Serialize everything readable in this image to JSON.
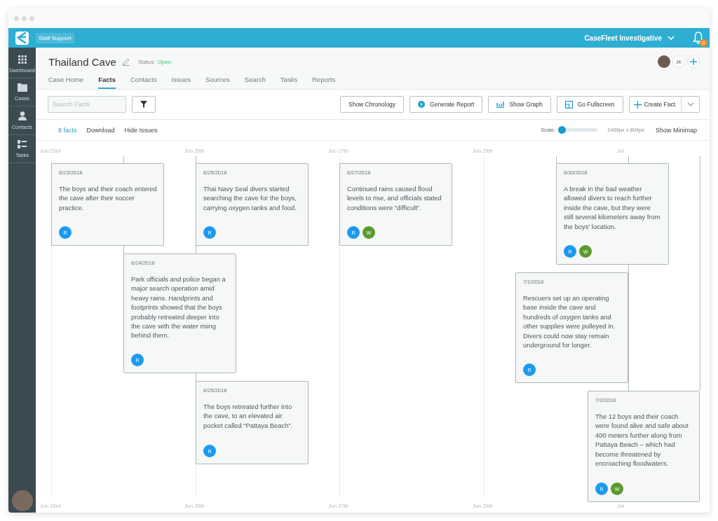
{
  "app_bar": {
    "workspace": "Staff Support",
    "account": "CaseFleet Investigative",
    "notification_count": "0"
  },
  "sidebar": {
    "items": [
      {
        "label": "Dashboard"
      },
      {
        "label": "Cases"
      },
      {
        "label": "Contacts"
      },
      {
        "label": "Tasks"
      }
    ]
  },
  "case": {
    "title": "Thailand Cave",
    "status_label": "Status:",
    "status": "Open",
    "collaborators": [
      "JK"
    ]
  },
  "tabs": [
    {
      "label": "Case Home",
      "selected": false
    },
    {
      "label": "Facts",
      "selected": true
    },
    {
      "label": "Contacts",
      "selected": false
    },
    {
      "label": "Issues",
      "selected": false
    },
    {
      "label": "Sources",
      "selected": false
    },
    {
      "label": "Search",
      "selected": false
    },
    {
      "label": "Tasks",
      "selected": false
    },
    {
      "label": "Reports",
      "selected": false
    }
  ],
  "search": {
    "placeholder": "Search Facts"
  },
  "buttons": [
    {
      "label": "Show Chronology"
    },
    {
      "label": "Generate Report"
    },
    {
      "label": "Show Graph"
    },
    {
      "label": "Go Fullscreen"
    },
    {
      "label": "Create Fact"
    }
  ],
  "subbar": {
    "count": "8 facts",
    "links": [
      "Download",
      "Hide Issues"
    ],
    "scale_label": "Scale:",
    "scale": {
      "level": 0
    },
    "dimensions": "1439px x 804px",
    "minimap": "Show Minimap"
  },
  "timeline": {
    "top_dates": [
      "Jun 23rd",
      "Jun 25th",
      "Jun 27th",
      "Jun 29th",
      "Jul"
    ],
    "bottom_dates": [
      "Jun 23rd",
      "Jun 25th",
      "Jun 27th",
      "Jun 29th",
      "Jul"
    ],
    "facts": [
      {
        "date": "6/23/2018",
        "text": "The boys and their coach entered the cave after their soccer practice.",
        "tags": [
          {
            "letter": "R",
            "color": "#1a9bf0"
          }
        ]
      },
      {
        "date": "6/25/2018",
        "text": "Thai Navy Seal divers started searching the cave for the boys, carrying oxygen tanks and food.",
        "tags": [
          {
            "letter": "R",
            "color": "#1a9bf0"
          }
        ]
      },
      {
        "date": "6/27/2018",
        "text": "Continued rains caused flood levels to rise, and officials stated conditions were “difficult”.",
        "tags": [
          {
            "letter": "R",
            "color": "#1a9bf0"
          },
          {
            "letter": "W",
            "color": "#5a9a2e"
          }
        ]
      },
      {
        "date": "6/30/2018",
        "text": "A break in the bad weather allowed divers to reach further inside the cave, but they were still several kilometers away from the boys' location.",
        "tags": [
          {
            "letter": "R",
            "color": "#1a9bf0"
          },
          {
            "letter": "W",
            "color": "#5a9a2e"
          }
        ]
      },
      {
        "date": "6/24/2018",
        "text": "Park officials and police began a major search operation amid heavy rains. Handprints and footprints showed that the boys probably retreated deeper into the cave with the water rising behind them.",
        "tags": [
          {
            "letter": "R",
            "color": "#1a9bf0"
          }
        ]
      },
      {
        "date": "7/1/2018",
        "text": "Rescuers set up an operating base inside the cave and hundreds of oxygen tanks and other supplies were pulleyed in. Divers could now stay remain underground for longer.",
        "tags": [
          {
            "letter": "R",
            "color": "#1a9bf0"
          }
        ]
      },
      {
        "date": "6/25/2018",
        "text": "The boys retreated further into the cave, to an elevated air pocket called “Pattaya Beach”.",
        "tags": [
          {
            "letter": "R",
            "color": "#1a9bf0"
          }
        ]
      },
      {
        "date": "7/2/2018",
        "text": "The 12 boys and their coach were found alive and safe about 400 meters further along from Pattaya Beach – which had become threatened by encroaching floodwaters.",
        "tags": [
          {
            "letter": "R",
            "color": "#1a9bf0"
          },
          {
            "letter": "W",
            "color": "#5a9a2e"
          }
        ]
      }
    ]
  }
}
